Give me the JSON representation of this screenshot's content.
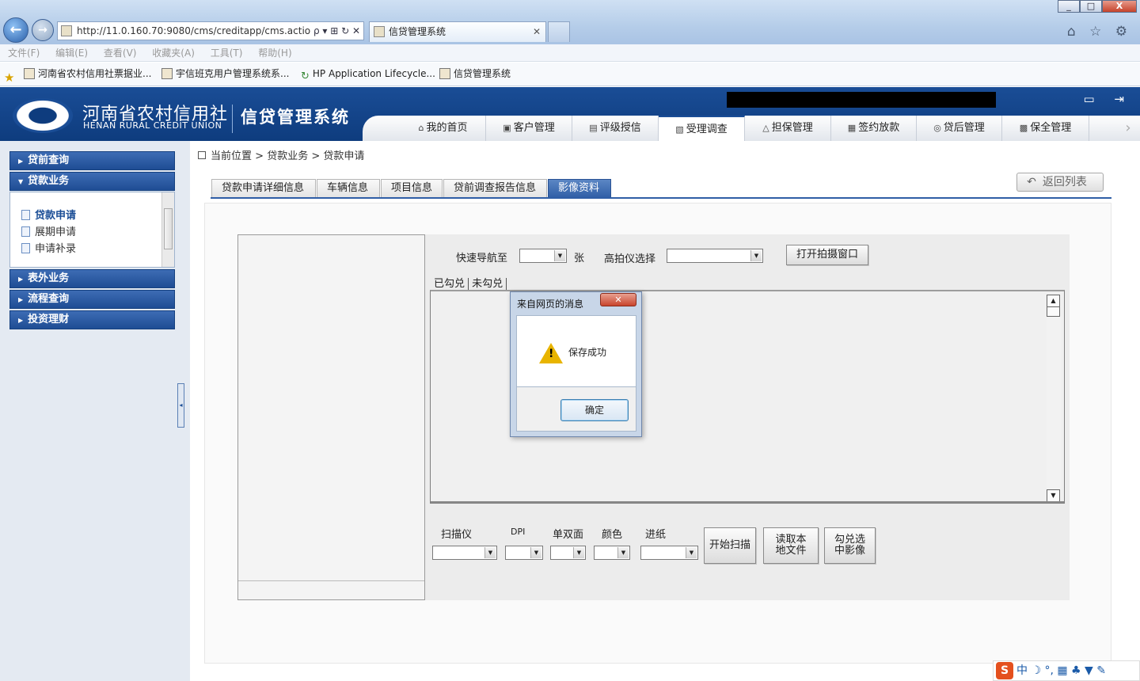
{
  "browser": {
    "address": "http://11.0.160.70:9080/cms/creditapp/cms.actio",
    "address_tools": "ρ ▾ ⊞ ↻ ✕",
    "tab_title": "信贷管理系统",
    "window_buttons": [
      "_",
      "□",
      "X"
    ],
    "menu": [
      "文件(F)",
      "编辑(E)",
      "查看(V)",
      "收藏夹(A)",
      "工具(T)",
      "帮助(H)"
    ],
    "favorites": [
      "河南省农村信用社票据业...",
      "宇信班克用户管理系统系...",
      "HP Application Lifecycle...",
      "信贷管理系统"
    ],
    "right_icons": "⌂ ☆ ⚙"
  },
  "header": {
    "org_cn": "河南省农村信用社",
    "org_en": "HENAN RURAL CREDIT UNION",
    "system_name": "信贷管理系统",
    "top_icons": "▭ ⇥",
    "nav": [
      {
        "label": "我的首页",
        "icon": "⌂"
      },
      {
        "label": "客户管理",
        "icon": "▣"
      },
      {
        "label": "评级授信",
        "icon": "▤"
      },
      {
        "label": "受理调查",
        "icon": "▧"
      },
      {
        "label": "担保管理",
        "icon": "△"
      },
      {
        "label": "签约放款",
        "icon": "▦"
      },
      {
        "label": "贷后管理",
        "icon": "◎"
      },
      {
        "label": "保全管理",
        "icon": "▩"
      }
    ],
    "nav_active": "受理调查",
    "nav_more": "›"
  },
  "sidebar": {
    "groups": [
      "贷前查询",
      "贷款业务",
      "表外业务",
      "流程查询",
      "投资理财"
    ],
    "expanded_group": "贷款业务",
    "items": [
      "贷款申请",
      "展期申请",
      "申请补录"
    ],
    "active_item": "贷款申请",
    "collapse_arrow": "◂"
  },
  "breadcrumb": {
    "current": "当前位置",
    "sep": ">",
    "level1": "贷款业务",
    "level2": "贷款申请"
  },
  "detail_tabs": [
    "贷款申请详细信息",
    "车辆信息",
    "项目信息",
    "贷前调查报告信息",
    "影像资料"
  ],
  "active_tab": "影像资料",
  "back_button": {
    "label": "返回列表",
    "icon": "↶"
  },
  "image_panel": {
    "quick_nav_label": "快速导航至",
    "quick_nav_unit": "张",
    "camera_label": "高拍仪选择",
    "open_camera_button": "打开拍摄窗口",
    "sub_tabs": [
      "已勾兑",
      "未勾兑"
    ],
    "scanner_label": "扫描仪",
    "dpi_label": "DPI",
    "duplex_label": "单双面",
    "color_label": "颜色",
    "feed_label": "进纸",
    "start_scan_button": "开始扫描",
    "read_local_button": "读取本地文件",
    "check_selected_button": "勾兑选中影像"
  },
  "dialog": {
    "title": "来自网页的消息",
    "close": "✕",
    "icon_glyph": "!",
    "message": "保存成功",
    "ok_button": "确定"
  },
  "ime": {
    "logo": "S",
    "text": "中 ☽ °, ▦ ♣ ▼ ✎"
  },
  "colors": {
    "brand_blue": "#1a4d96",
    "active_tab": "#2f5ea6",
    "warning": "#e8b400"
  }
}
